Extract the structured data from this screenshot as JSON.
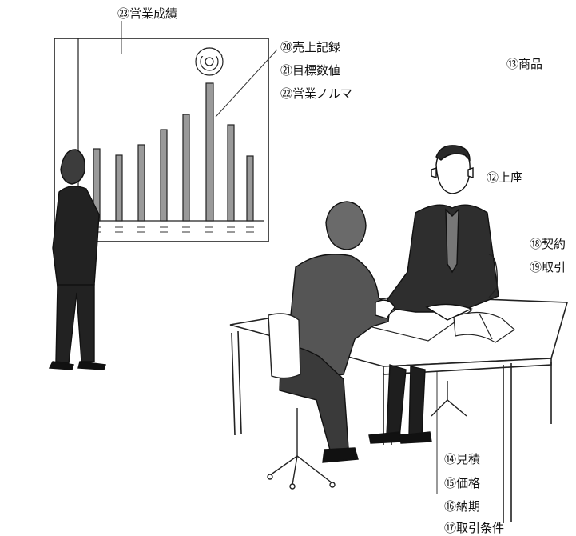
{
  "labels": {
    "l23": "㉓営業成績",
    "l20": "⑳売上記録",
    "l21": "㉑目標数値",
    "l22": "㉒営業ノルマ",
    "l13": "⑬商品",
    "l12": "⑫上座",
    "l18": "⑱契約",
    "l19": "⑲取引",
    "l14": "⑭見積",
    "l15": "⑮価格",
    "l16": "⑯納期",
    "l17": "⑰取引条件"
  }
}
